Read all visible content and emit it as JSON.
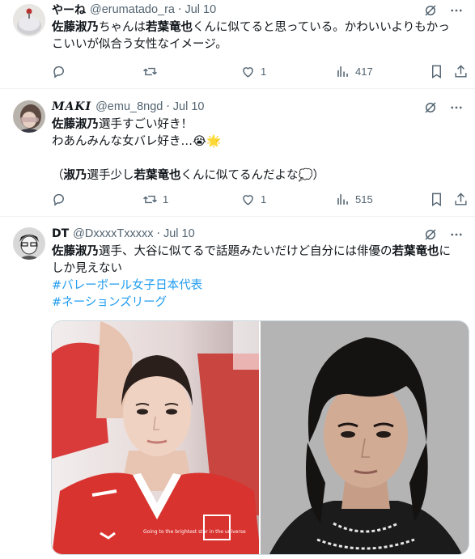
{
  "tweets": [
    {
      "name": "やーね",
      "handle": "@erumatado_ra",
      "date": "Jul 10",
      "line1_a": "佐藤淑乃",
      "line1_b": "ちゃんは",
      "line1_c": "若葉竜也",
      "line1_d": "くんに似てると思っている。かわいいよりもかっ",
      "line2": "こいいが似合う女性なイメージ。",
      "replies": "",
      "retweets": "",
      "likes": "1",
      "views": "417"
    },
    {
      "name": "𝑴𝑨𝑲𝑰",
      "handle": "@emu_8ngd",
      "date": "Jul 10",
      "line1_a": "佐藤淑乃",
      "line1_b": "選手すごい好き！",
      "line2": "わあんみんな女バレ好き…😭🌟",
      "line3_a": "（",
      "line3_b": "淑乃",
      "line3_c": "選手少し",
      "line3_d": "若葉竜也",
      "line3_e": "くんに似てるんだよな💭）",
      "replies": "",
      "retweets": "1",
      "likes": "1",
      "views": "515"
    },
    {
      "name": "DT",
      "handle": "@DxxxxTxxxxx",
      "date": "Jul 10",
      "line1_a": "佐藤淑乃",
      "line1_b": "選手、大谷に似てるで話題みたいだけど自分には俳優の",
      "line1_c": "若葉竜也",
      "line1_d": "に",
      "line2": "しか見えない",
      "hashtag1": "#バレーボール女子日本代表",
      "hashtag2": "#ネーションズリーグ",
      "jersey_text": "Going to the brightest star in the universe"
    }
  ],
  "colors": {
    "text": "#0f1419",
    "muted": "#536471",
    "link": "#1d9bf0",
    "divider": "#eff3f4"
  }
}
